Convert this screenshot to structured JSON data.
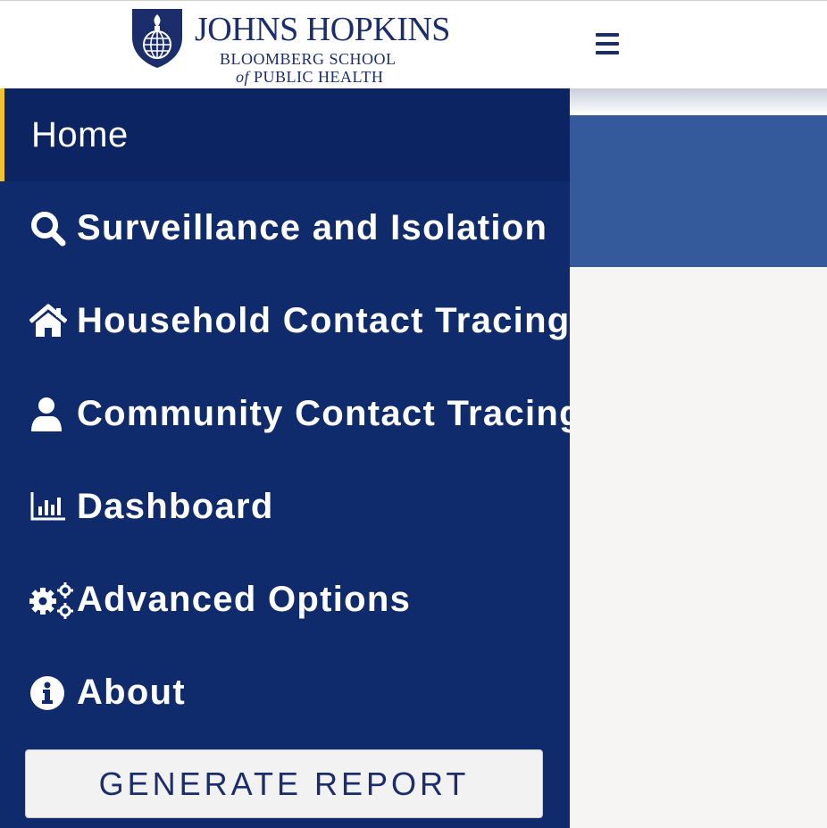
{
  "header": {
    "logo": {
      "line1": "JOHNS HOPKINS",
      "line2": "BLOOMBERG SCHOOL",
      "line3_of": "of",
      "line3_rest": "PUBLIC HEALTH"
    },
    "menu_icon": "hamburger-icon"
  },
  "sidebar": {
    "items": [
      {
        "label": "Home",
        "icon": "",
        "active": true
      },
      {
        "label": "Surveillance and Isolation",
        "icon": "search-icon"
      },
      {
        "label": "Household Contact Tracing",
        "icon": "home-icon"
      },
      {
        "label": "Community Contact Tracing",
        "icon": "user-icon"
      },
      {
        "label": "Dashboard",
        "icon": "bar-chart-icon"
      },
      {
        "label": "Advanced Options",
        "icon": "gears-icon"
      },
      {
        "label": "About",
        "icon": "info-icon"
      }
    ],
    "report_button": "GENERATE REPORT"
  },
  "colors": {
    "sidebar_bg": "#0f2b6b",
    "active_bg": "#0c2562",
    "active_accent": "#f2c230",
    "brand_navy": "#1b2d6b",
    "main_band": "#345a9c"
  }
}
